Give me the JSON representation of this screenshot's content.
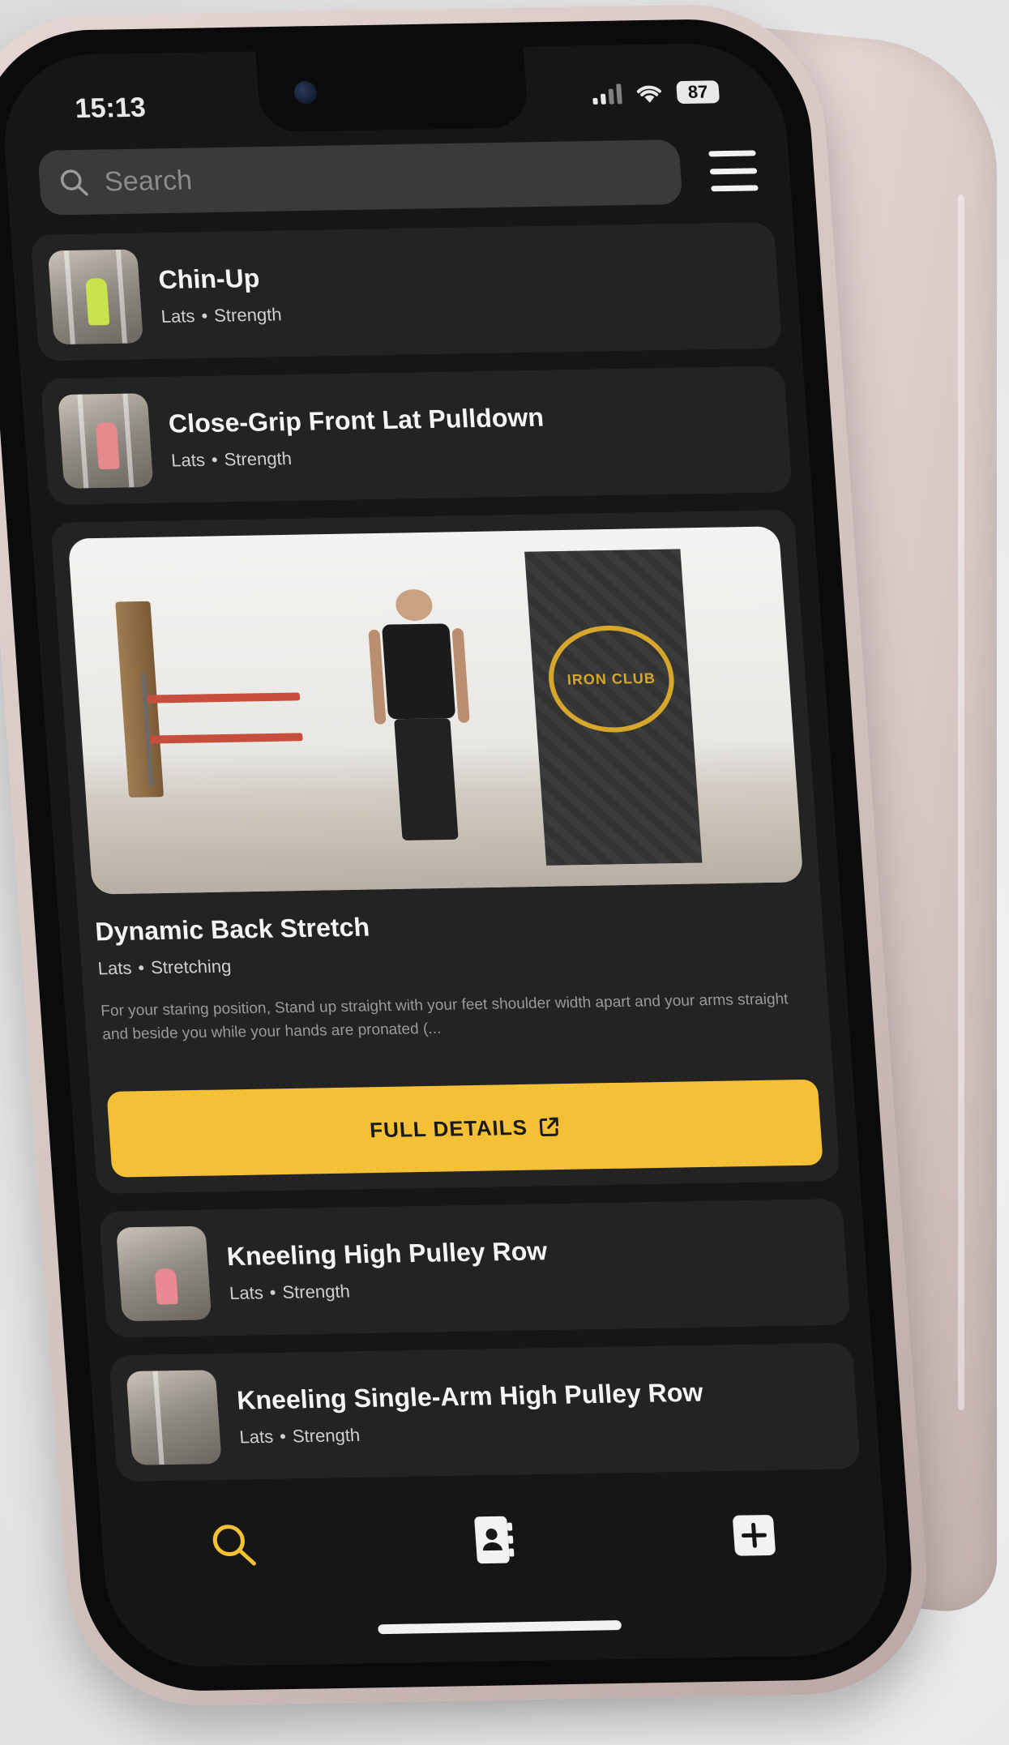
{
  "status_bar": {
    "time": "15:13",
    "battery": "87"
  },
  "search": {
    "placeholder": "Search"
  },
  "exercises": [
    {
      "title": "Chin-Up",
      "muscle": "Lats",
      "category": "Strength"
    },
    {
      "title": "Close-Grip Front Lat Pulldown",
      "muscle": "Lats",
      "category": "Strength"
    },
    {
      "title": "Dynamic Back Stretch",
      "muscle": "Lats",
      "category": "Stretching",
      "description": "For your staring position, Stand up straight with your feet shoulder width apart and your arms straight and beside you while your hands are pronated (...",
      "button_label": "FULL DETAILS",
      "banner_text": "IRON CLUB"
    },
    {
      "title": "Kneeling High Pulley Row",
      "muscle": "Lats",
      "category": "Strength"
    },
    {
      "title": "Kneeling Single-Arm High Pulley Row",
      "muscle": "Lats",
      "category": "Strength"
    }
  ],
  "meta_separator": "•",
  "tabs": [
    {
      "icon": "search-icon",
      "active": true
    },
    {
      "icon": "contacts-book-icon",
      "active": false
    },
    {
      "icon": "add-square-icon",
      "active": false
    }
  ],
  "colors": {
    "accent": "#f4c136",
    "background": "#161616",
    "card": "#232323",
    "search_bg": "#3a3a3a",
    "phone_body": "#d9c9c6"
  }
}
